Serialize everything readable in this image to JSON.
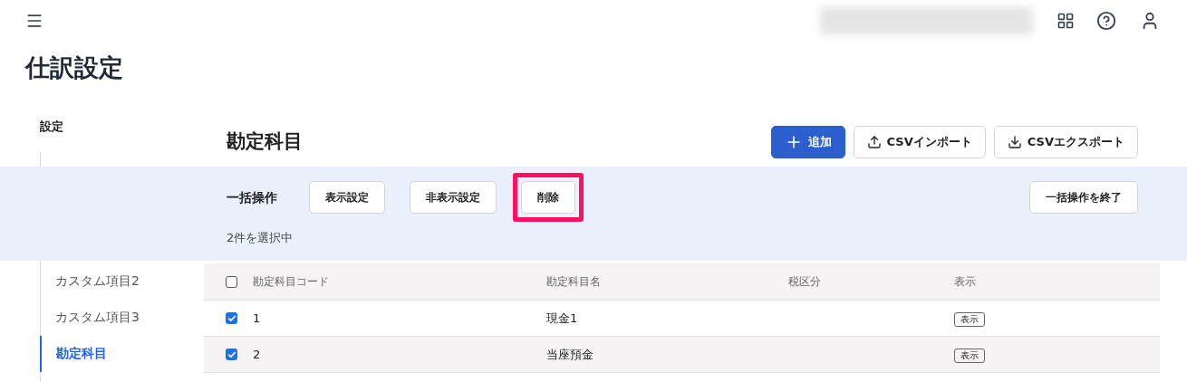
{
  "page_title": "仕訳設定",
  "sidebar": {
    "heading": "設定",
    "items": [
      {
        "label": "カスタム項目2",
        "selected": false
      },
      {
        "label": "カスタム項目3",
        "selected": false
      },
      {
        "label": "勘定科目",
        "selected": true
      }
    ]
  },
  "section": {
    "title": "勘定科目",
    "actions": [
      {
        "label": "追加",
        "kind": "primary"
      },
      {
        "label": "CSVインポート",
        "kind": "secondary"
      },
      {
        "label": "CSVエクスポート",
        "kind": "secondary"
      }
    ]
  },
  "bulk_bar": {
    "label": "一括操作",
    "buttons": [
      {
        "label": "表示設定",
        "highlighted": false
      },
      {
        "label": "非表示設定",
        "highlighted": false
      },
      {
        "label": "削除",
        "highlighted": true
      }
    ],
    "end_button": "一括操作を終了",
    "selection_count": "2件を選択中"
  },
  "table": {
    "select_all_checked": false,
    "columns": [
      "勘定科目コード",
      "勘定科目名",
      "税区分",
      "表示"
    ],
    "rows": [
      {
        "checked": true,
        "code": "1",
        "name": "現金1",
        "badge": "表示"
      },
      {
        "checked": true,
        "code": "2",
        "name": "当座預金",
        "badge": "表示"
      }
    ]
  }
}
